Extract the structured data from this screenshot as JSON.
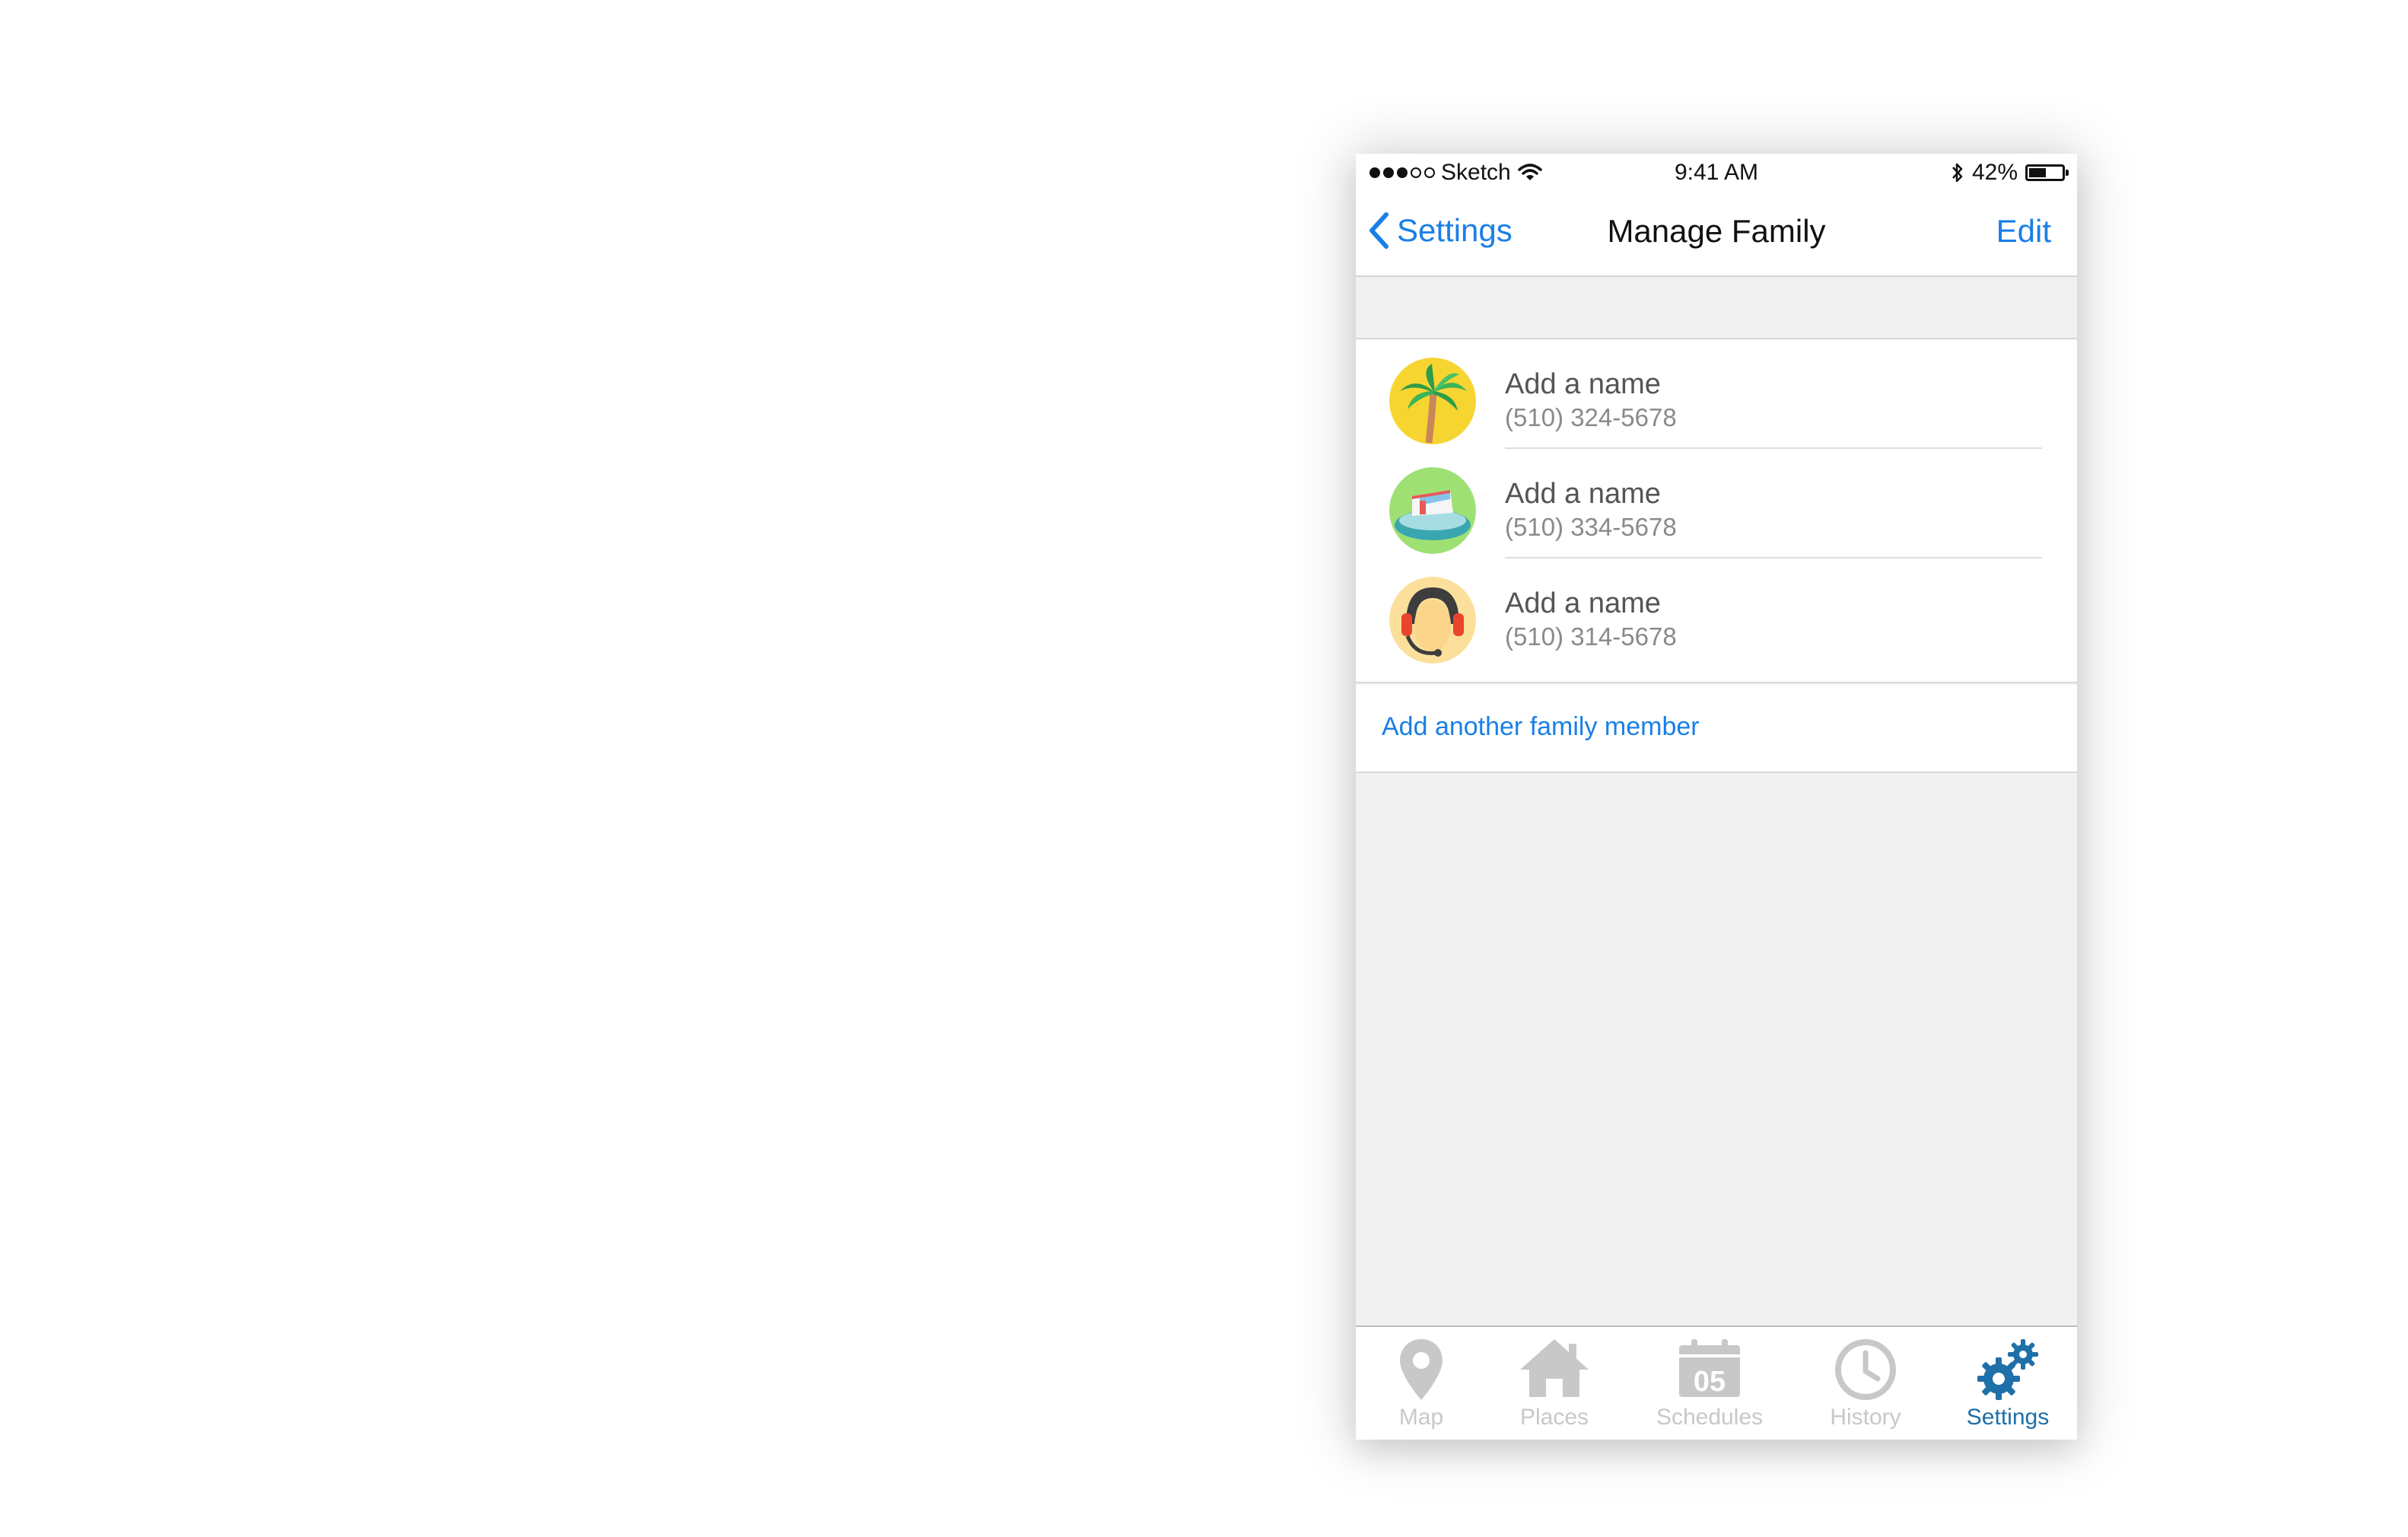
{
  "status_bar": {
    "carrier": "Sketch",
    "time": "9:41 AM",
    "battery": "42%"
  },
  "nav": {
    "back_label": "Settings",
    "title": "Manage Family",
    "edit_label": "Edit"
  },
  "members": [
    {
      "name": "Add a name",
      "phone": "(510) 324-5678",
      "avatar_icon": "palm-tree-icon"
    },
    {
      "name": "Add a name",
      "phone": "(510) 334-5678",
      "avatar_icon": "boat-icon"
    },
    {
      "name": "Add a name",
      "phone": "(510) 314-5678",
      "avatar_icon": "headset-person-icon"
    }
  ],
  "add_member_label": "Add another family member",
  "tabs": [
    {
      "label": "Map",
      "icon": "map-pin-icon"
    },
    {
      "label": "Places",
      "icon": "home-icon"
    },
    {
      "label": "Schedules",
      "icon": "calendar-icon",
      "calendar_day": "05"
    },
    {
      "label": "History",
      "icon": "clock-icon"
    },
    {
      "label": "Settings",
      "icon": "gears-icon",
      "active": true
    }
  ],
  "colors": {
    "accent": "#1a7fe6",
    "active_tab": "#1f6fa8",
    "inactive_tab": "#c8c8c8",
    "background": "#f1f1f1"
  }
}
